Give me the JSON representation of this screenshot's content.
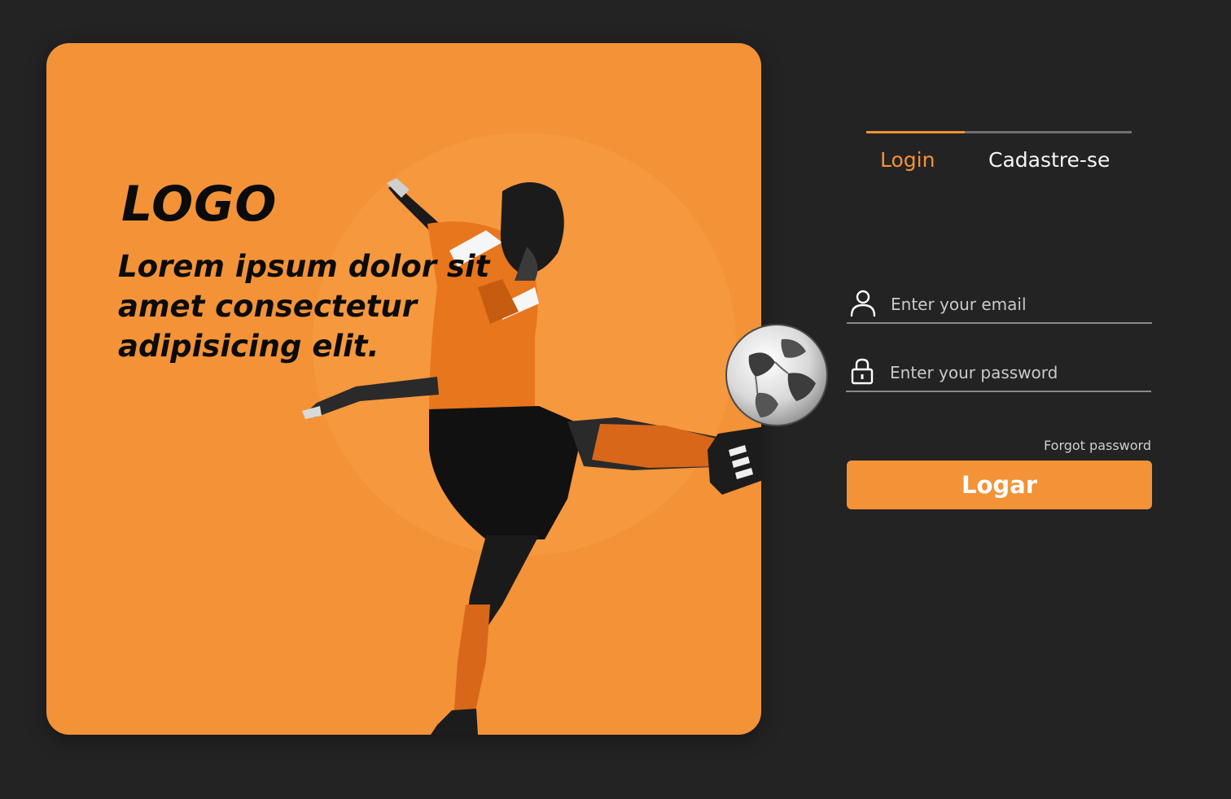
{
  "hero": {
    "logo": "LOGO",
    "tagline": "Lorem ipsum dolor sit amet consectetur adipisicing elit.",
    "image": "soccer-player-kicking-ball"
  },
  "tabs": [
    {
      "label": "Login",
      "active": true
    },
    {
      "label": "Cadastre-se",
      "active": false
    }
  ],
  "form": {
    "email": {
      "placeholder": "Enter your email",
      "value": "",
      "icon": "user-icon"
    },
    "password": {
      "placeholder": "Enter your password",
      "value": "",
      "icon": "lock-icon"
    },
    "forgot_label": "Forgot password",
    "submit_label": "Logar"
  },
  "colors": {
    "background": "#232323",
    "accent": "#f39237",
    "text_light": "#f5f5f5",
    "text_dark": "#0b0b0b"
  }
}
